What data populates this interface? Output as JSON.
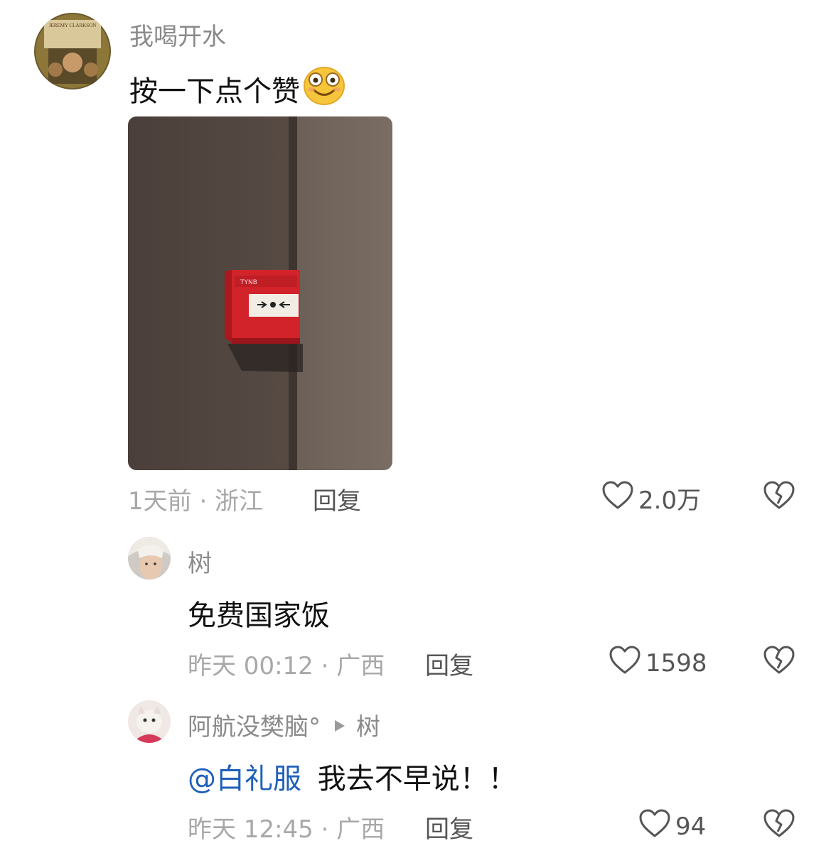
{
  "comments": [
    {
      "user": "我喝开水",
      "text": "按一下点个赞",
      "emoji": "smiling-face-emoji",
      "time_location": "1天前 · 浙江",
      "reply_label": "回复",
      "likes": "2.0万",
      "avatar_label": "JEREMY CLARKSON"
    },
    {
      "user": "树",
      "text": "免费国家饭",
      "time_location": "昨天 00:12 · 广西",
      "reply_label": "回复",
      "likes": "1598"
    },
    {
      "user": "阿航没樊脑°",
      "reply_to": "树",
      "mention": "@白礼服",
      "text": "我去不早说！！",
      "time_location": "昨天 12:45 · 广西",
      "reply_label": "回复",
      "likes": "94"
    }
  ],
  "colors": {
    "text": "#111111",
    "username": "#8a8a8a",
    "meta": "#a8a8a8",
    "mention": "#1f5fb8",
    "alarm_red": "#d2232a"
  }
}
